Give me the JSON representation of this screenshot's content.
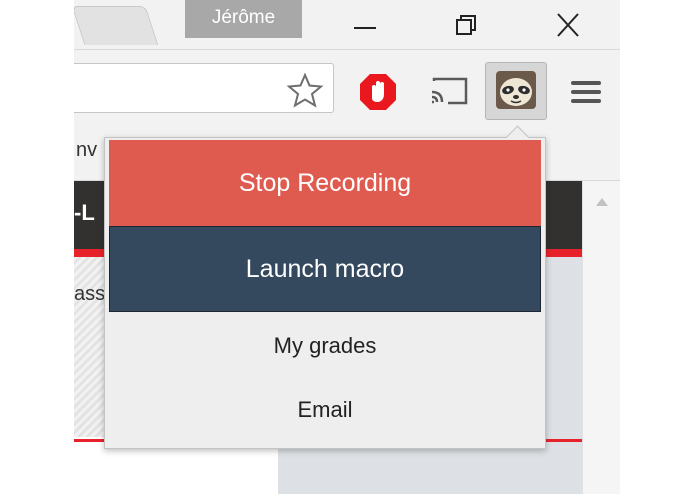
{
  "window": {
    "profile_name": "Jérôme"
  },
  "toolbar": {
    "icons": [
      "star-icon",
      "adblock-icon",
      "cast-icon",
      "sloth-extension-icon",
      "menu-icon"
    ]
  },
  "page_fragments": {
    "bookmark_fragment": "nv",
    "header_fragment": "-L",
    "body_fragment": "ass"
  },
  "popup": {
    "stop_label": "Stop Recording",
    "macro_label": "Launch macro",
    "grades_label": "My grades",
    "email_label": "Email"
  },
  "colors": {
    "stop_button": "#e05b4f",
    "macro_button": "#34495e",
    "site_header": "#333130",
    "accent_red": "#e8222a"
  }
}
